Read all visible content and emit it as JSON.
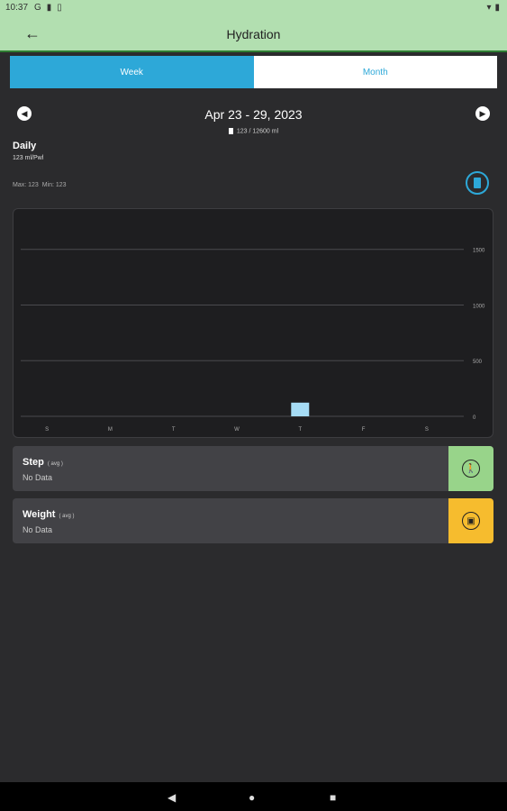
{
  "status": {
    "time": "10:37"
  },
  "appbar": {
    "title": "Hydration"
  },
  "tabs": [
    {
      "label": "Week",
      "active": true
    },
    {
      "label": "Month",
      "active": false
    }
  ],
  "date_range": "Apr  23 - 29, 2023",
  "total": "123 / 12600 ml",
  "daily": {
    "label": "Daily",
    "value": "123 ml/Pwl"
  },
  "maxmin": {
    "max": "Max: 123",
    "min": "Min: 123"
  },
  "chart_data": {
    "type": "bar",
    "categories": [
      "S",
      "M",
      "T",
      "W",
      "T",
      "F",
      "S"
    ],
    "values": [
      0,
      0,
      0,
      0,
      123,
      0,
      0
    ],
    "y_ticks": [
      0,
      500,
      1000,
      1500
    ],
    "ylim": [
      0,
      1700
    ],
    "bar_color": "#a6dcf5",
    "grid": true
  },
  "cards": [
    {
      "title": "Step",
      "avg": "( avg )",
      "value": "No Data",
      "icon": "walk-icon",
      "color": "#98d48a"
    },
    {
      "title": "Weight",
      "avg": "( avg )",
      "value": "No Data",
      "icon": "scale-icon",
      "color": "#f6bc2e"
    }
  ],
  "colors": {
    "accent": "#2da8d8",
    "appbar": "#b2dfb0",
    "background": "#2b2b2d"
  }
}
